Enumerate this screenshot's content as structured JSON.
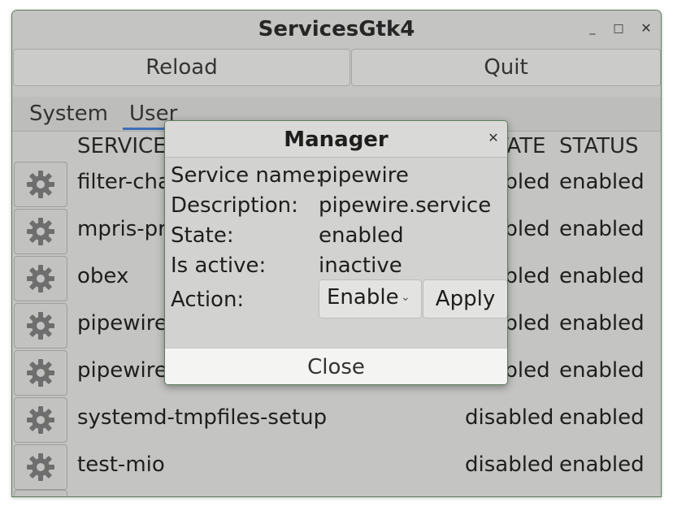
{
  "window": {
    "title": "ServicesGtk4",
    "minimize_glyph": "_",
    "maximize_glyph": "□",
    "close_glyph": "✕"
  },
  "toolbar": {
    "reload_label": "Reload",
    "quit_label": "Quit"
  },
  "tabs": [
    {
      "label": "System",
      "active": false
    },
    {
      "label": "User",
      "active": true
    }
  ],
  "table": {
    "headers": {
      "service": "SERVICE",
      "state": "STATE",
      "status": "STATUS"
    },
    "rows": [
      {
        "name": "filter-chain",
        "state": "enabled",
        "status": "enabled"
      },
      {
        "name": "mpris-proxy",
        "state": "enabled",
        "status": "enabled"
      },
      {
        "name": "obex",
        "state": "enabled",
        "status": "enabled"
      },
      {
        "name": "pipewire",
        "state": "enabled",
        "status": "enabled"
      },
      {
        "name": "pipewire-pulse",
        "state": "enabled",
        "status": "enabled"
      },
      {
        "name": "systemd-tmpfiles-setup",
        "state": "disabled",
        "status": "enabled"
      },
      {
        "name": "test-mio",
        "state": "disabled",
        "status": "enabled"
      }
    ],
    "row_icon": "gear-icon"
  },
  "dialog": {
    "title": "Manager",
    "close_glyph": "✕",
    "service_name_label": "Service name:",
    "service_name_value": "pipewire",
    "description_label": "Description:",
    "description_value": "pipewire.service",
    "state_label": "State:",
    "state_value": "enabled",
    "is_active_label": "Is active:",
    "is_active_value": "inactive",
    "action_label": "Action:",
    "action_selected": "Enable",
    "apply_label": "Apply",
    "close_button_label": "Close"
  },
  "colors": {
    "accent": "#3f6fb6",
    "window_bg": "#c4c4c2",
    "border": "#5d7d5d"
  }
}
